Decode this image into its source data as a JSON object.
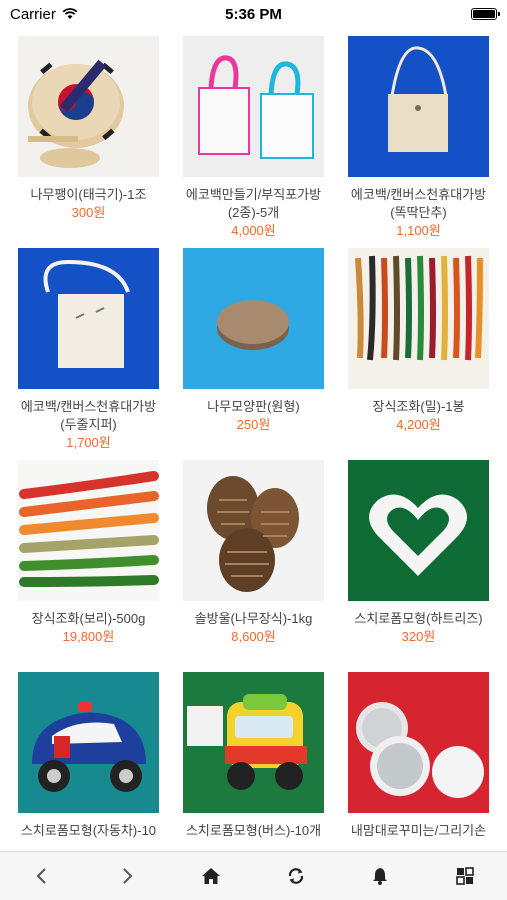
{
  "status_bar": {
    "carrier": "Carrier",
    "time": "5:36 PM"
  },
  "products": [
    {
      "name": "나무팽이(태극기)-1조",
      "price": "300원"
    },
    {
      "name": "에코백만들기/부직포가방\n(2종)-5개",
      "price": "4,000원"
    },
    {
      "name": "에코백/캔버스천휴대가방\n(똑딱단추)",
      "price": "1,100원"
    },
    {
      "name": "에코백/캔버스천휴대가방\n(두줄지퍼)",
      "price": "1,700원"
    },
    {
      "name": "나무모양판(원형)",
      "price": "250원"
    },
    {
      "name": "장식조화(밀)-1봉",
      "price": "4,200원"
    },
    {
      "name": "장식조화(보리)-500g",
      "price": "19,800원"
    },
    {
      "name": "솔방울(나무장식)-1kg",
      "price": "8,600원"
    },
    {
      "name": "스치로폼모형(하트리즈)",
      "price": "320원"
    },
    {
      "name": "스치로폼모형(자동차)-10",
      "price": ""
    },
    {
      "name": "스치로폼모형(버스)-10개",
      "price": ""
    },
    {
      "name": "내맘대로꾸미는/그리기손",
      "price": ""
    }
  ],
  "bottom_nav": [
    "back-icon",
    "forward-icon",
    "home-icon",
    "refresh-icon",
    "bell-icon",
    "qr-icon"
  ],
  "colors": {
    "price": "#f06a2f",
    "nav_bg": "#f7f7f7"
  }
}
